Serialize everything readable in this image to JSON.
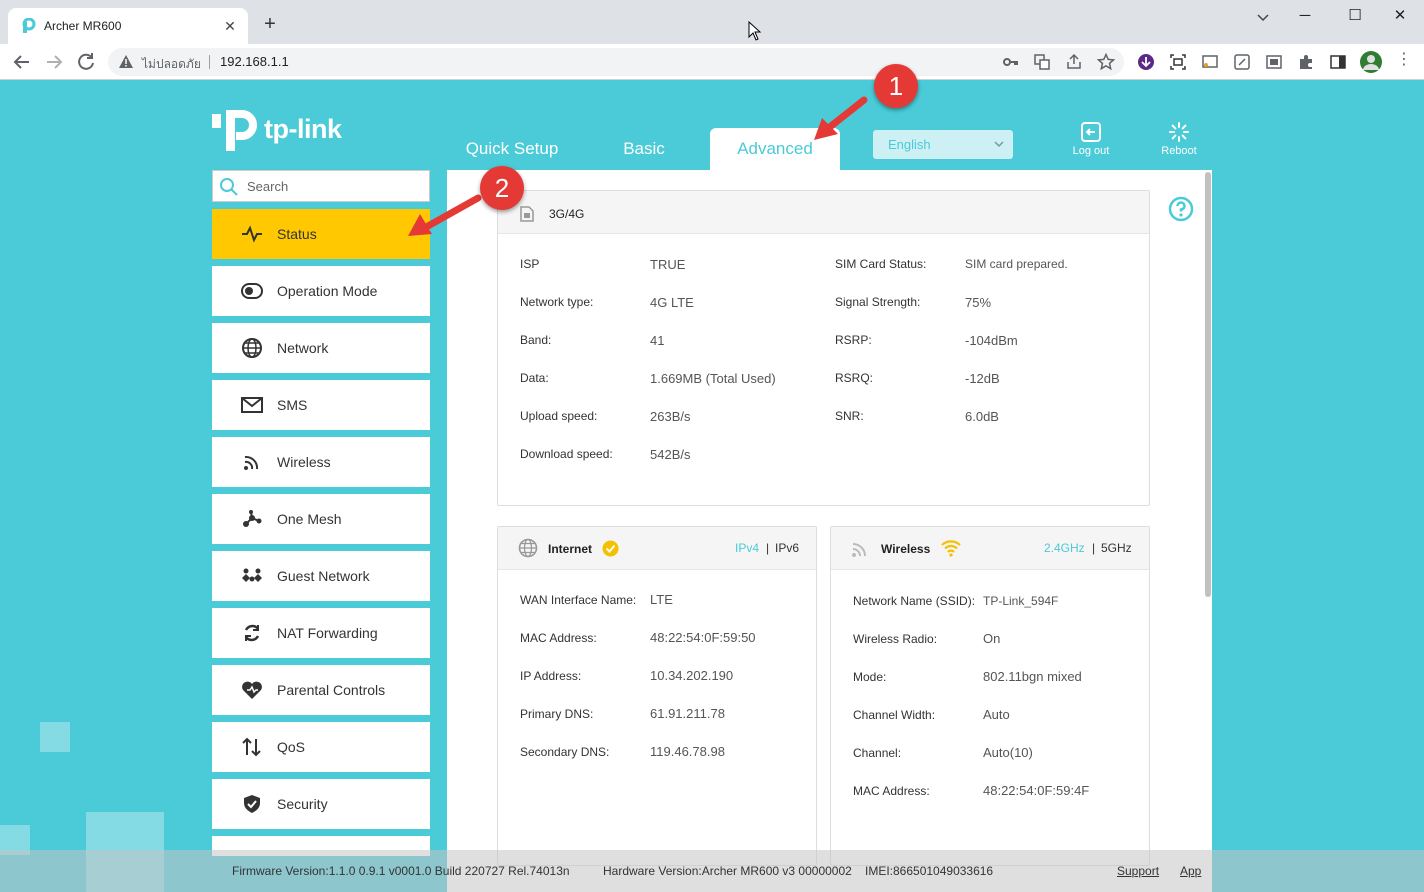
{
  "browser": {
    "tab_title": "Archer MR600",
    "security_label": "ไม่ปลอดภัย",
    "url": "192.168.1.1"
  },
  "brand": {
    "logo_text": "tp-link"
  },
  "header": {
    "tabs": [
      {
        "label": "Quick Setup",
        "active": false
      },
      {
        "label": "Basic",
        "active": false
      },
      {
        "label": "Advanced",
        "active": true
      }
    ],
    "language": "English",
    "logout_label": "Log out",
    "reboot_label": "Reboot"
  },
  "sidebar": {
    "search_placeholder": "Search",
    "items": [
      {
        "label": "Status",
        "icon": "pulse-icon",
        "active": true
      },
      {
        "label": "Operation Mode",
        "icon": "toggle-icon"
      },
      {
        "label": "Network",
        "icon": "globe-icon"
      },
      {
        "label": "SMS",
        "icon": "envelope-icon"
      },
      {
        "label": "Wireless",
        "icon": "wifi-icon"
      },
      {
        "label": "One Mesh",
        "icon": "mesh-icon"
      },
      {
        "label": "Guest Network",
        "icon": "guest-icon"
      },
      {
        "label": "NAT Forwarding",
        "icon": "nat-icon"
      },
      {
        "label": "Parental Controls",
        "icon": "heart-icon"
      },
      {
        "label": "QoS",
        "icon": "updown-arrows-icon"
      },
      {
        "label": "Security",
        "icon": "shield-icon"
      }
    ]
  },
  "panels": {
    "cellular": {
      "title": "3G/4G",
      "left": [
        {
          "label": "ISP",
          "value": "TRUE"
        },
        {
          "label": "Network type:",
          "value": "4G LTE"
        },
        {
          "label": "Band:",
          "value": "41"
        },
        {
          "label": "Data:",
          "value": "1.669MB (Total Used)"
        },
        {
          "label": "Upload speed:",
          "value": "263B/s"
        },
        {
          "label": "Download speed:",
          "value": "542B/s"
        }
      ],
      "right": [
        {
          "label": "SIM Card Status:",
          "value": "SIM card prepared."
        },
        {
          "label": "Signal Strength:",
          "value": "75%"
        },
        {
          "label": "RSRP:",
          "value": "-104dBm"
        },
        {
          "label": "RSRQ:",
          "value": "-12dB"
        },
        {
          "label": "SNR:",
          "value": "6.0dB"
        }
      ]
    },
    "internet": {
      "title": "Internet",
      "proto_a": "IPv4",
      "proto_b": "IPv6",
      "rows": [
        {
          "label": "WAN Interface Name:",
          "value": "LTE"
        },
        {
          "label": "MAC Address:",
          "value": "48:22:54:0F:59:50"
        },
        {
          "label": "IP Address:",
          "value": "10.34.202.190"
        },
        {
          "label": "Primary DNS:",
          "value": "61.91.211.78"
        },
        {
          "label": "Secondary DNS:",
          "value": "119.46.78.98"
        }
      ]
    },
    "wireless": {
      "title": "Wireless",
      "band_a": "2.4GHz",
      "band_b": "5GHz",
      "rows": [
        {
          "label": "Network Name (SSID):",
          "value": "TP-Link_594F"
        },
        {
          "label": "Wireless Radio:",
          "value": "On"
        },
        {
          "label": "Mode:",
          "value": "802.11bgn mixed"
        },
        {
          "label": "Channel Width:",
          "value": "Auto"
        },
        {
          "label": "Channel:",
          "value": "Auto(10)"
        },
        {
          "label": "MAC Address:",
          "value": "48:22:54:0F:59:4F"
        }
      ]
    }
  },
  "footer": {
    "firmware": "Firmware Version:1.1.0 0.9.1 v0001.0 Build 220727 Rel.74013n",
    "hardware": "Hardware Version:Archer MR600 v3 00000002",
    "imei": "IMEI:866501049033616",
    "support": "Support",
    "app": "App"
  },
  "annotations": {
    "marker_1": "1",
    "marker_2": "2"
  },
  "colors": {
    "brand": "#4acbd7",
    "active_item": "#ffc800",
    "marker": "#e53935"
  }
}
